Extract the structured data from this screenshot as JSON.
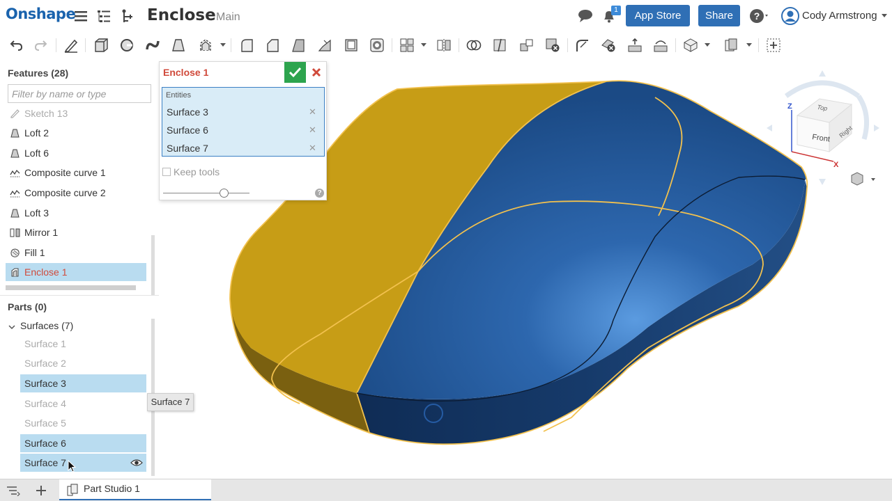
{
  "app": {
    "logo": "Onshape",
    "document_title": "Enclose",
    "workspace": "Main"
  },
  "header": {
    "notification_count": "1",
    "app_store_label": "App Store",
    "share_label": "Share",
    "user_name": "Cody Armstrong"
  },
  "toolbar": {
    "icons": [
      "undo-icon",
      "redo-icon",
      "sketch-icon",
      "extrude-icon",
      "revolve-icon",
      "sweep-icon",
      "loft-icon",
      "thicken-icon",
      "fillet-icon",
      "chamfer-icon",
      "draft-icon",
      "rib-icon",
      "shell-icon",
      "hole-icon",
      "pattern-icon",
      "mirror-icon",
      "boolean-icon",
      "split-icon",
      "transform-icon",
      "delete-part-icon",
      "modify-fillet-icon",
      "delete-face-icon",
      "move-face-icon",
      "replace-face-icon",
      "plane-icon",
      "mate-connector-icon",
      "add-custom-feature-icon"
    ]
  },
  "features": {
    "title": "Features (28)",
    "filter_placeholder": "Filter by name or type",
    "items": [
      {
        "label": "Sketch 13",
        "icon": "sketch-icon"
      },
      {
        "label": "Loft 2",
        "icon": "loft-icon"
      },
      {
        "label": "Loft 6",
        "icon": "loft-icon"
      },
      {
        "label": "Composite curve 1",
        "icon": "composite-curve-icon"
      },
      {
        "label": "Composite curve 2",
        "icon": "composite-curve-icon"
      },
      {
        "label": "Loft 3",
        "icon": "loft-icon"
      },
      {
        "label": "Mirror 1",
        "icon": "mirror-icon"
      },
      {
        "label": "Fill 1",
        "icon": "fill-icon"
      },
      {
        "label": "Enclose 1",
        "icon": "enclose-icon"
      }
    ]
  },
  "parts": {
    "title": "Parts (0)",
    "surfaces_group": "Surfaces (7)",
    "surfaces": [
      {
        "label": "Surface 1",
        "selected": false
      },
      {
        "label": "Surface 2",
        "selected": false
      },
      {
        "label": "Surface 3",
        "selected": true
      },
      {
        "label": "Surface 4",
        "selected": false
      },
      {
        "label": "Surface 5",
        "selected": false
      },
      {
        "label": "Surface 6",
        "selected": true
      },
      {
        "label": "Surface 7",
        "selected": true
      }
    ],
    "tooltip": "Surface 7"
  },
  "dialog": {
    "title": "Enclose 1",
    "entities_label": "Entities",
    "entities": [
      "Surface 3",
      "Surface 6",
      "Surface 7"
    ],
    "keep_tools_label": "Keep tools",
    "keep_tools_checked": false,
    "slider_fraction": 0.7
  },
  "view_cube": {
    "faces": [
      "Front",
      "Top",
      "Right"
    ],
    "axes": [
      "Z",
      "X"
    ]
  },
  "bottom": {
    "tab_label": "Part Studio 1"
  },
  "colors": {
    "brand_blue": "#1a63ad",
    "button_blue": "#2f6fb5",
    "selection_bg": "#b9dcf0",
    "active_feature_red": "#d04a3b",
    "ok_green": "#2da44e",
    "surface_gold": "#c9a21a",
    "surface_blue": "#1d4f8a",
    "highlight_edge": "#f2c14e"
  }
}
